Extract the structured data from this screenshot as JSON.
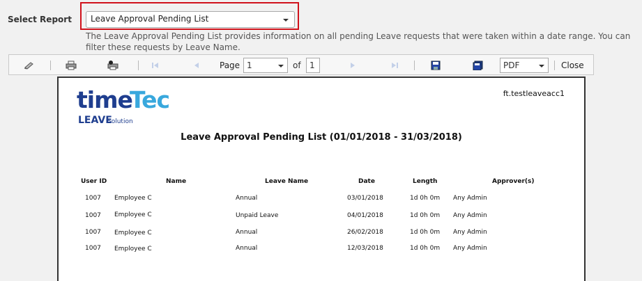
{
  "header": {
    "select_label": "Select Report",
    "selected_report": "Leave Approval Pending List",
    "description": "The Leave Approval Pending List provides information on all pending Leave requests that were taken within a date range. You can filter these requests by Leave Name."
  },
  "toolbar": {
    "page_label": "Page",
    "page_value": "1",
    "of_label": "of",
    "total_pages": "1",
    "format_value": "PDF",
    "close_label": "Close",
    "icons": [
      "edit-icon",
      "print-icon",
      "print-setup-icon",
      "first-page-icon",
      "prev-page-icon",
      "next-page-icon",
      "last-page-icon",
      "save-icon",
      "save-as-icon"
    ]
  },
  "report": {
    "logo": {
      "part1": "time",
      "part2": "Tec",
      "leave": "LEAVE",
      "solution": "Solution"
    },
    "account": "ft.testleaveacc1",
    "title": "Leave Approval Pending List (01/01/2018 - 31/03/2018)",
    "columns": [
      "User ID",
      "Name",
      "Leave Name",
      "Date",
      "Length",
      "Approver(s)"
    ],
    "rows": [
      {
        "user_id": "1007",
        "name": "Employee C",
        "leave_name": "Annual",
        "date": "03/01/2018",
        "length": "1d 0h 0m",
        "approver": "Any Admin"
      },
      {
        "user_id": "1007",
        "name": "Employee C",
        "leave_name": "Unpaid Leave",
        "date": "04/01/2018",
        "length": "1d 0h 0m",
        "approver": "Any Admin"
      },
      {
        "user_id": "1007",
        "name": "Employee C",
        "leave_name": "Annual",
        "date": "26/02/2018",
        "length": "1d 0h 0m",
        "approver": "Any Admin"
      },
      {
        "user_id": "1007",
        "name": "Employee C",
        "leave_name": "Annual",
        "date": "12/03/2018",
        "length": "1d 0h 0m",
        "approver": "Any Admin"
      }
    ]
  }
}
